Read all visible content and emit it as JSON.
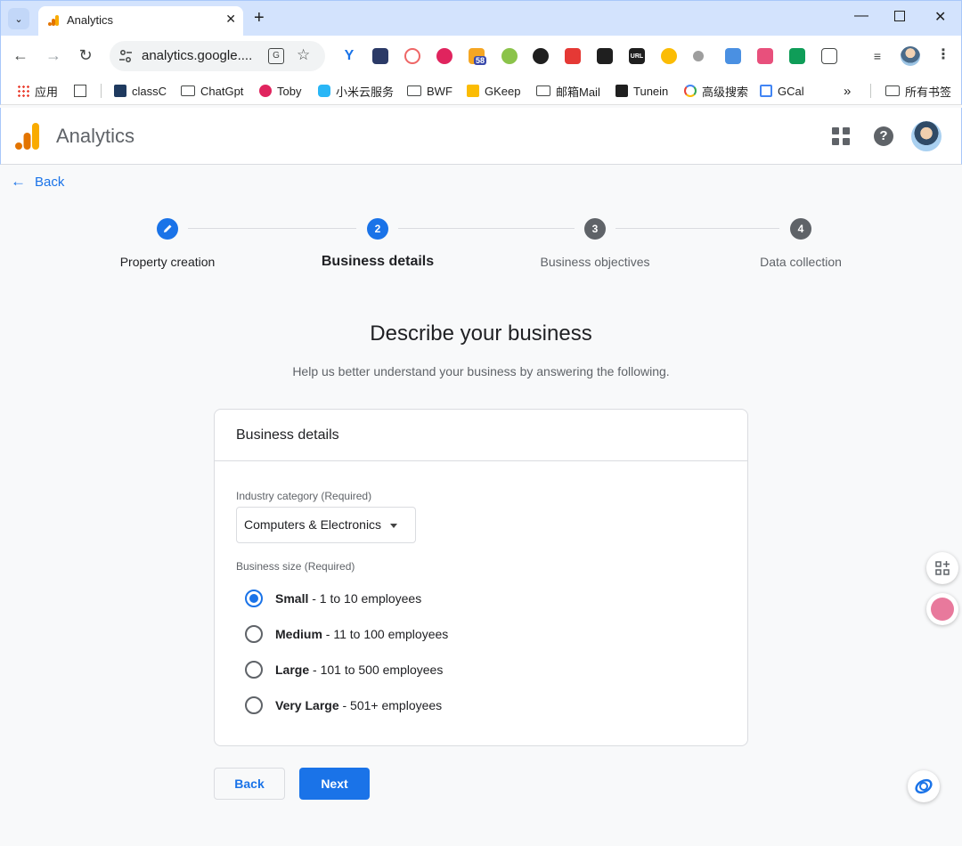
{
  "browser": {
    "tab_title": "Analytics",
    "url": "analytics.google....",
    "translate_glyph": "G",
    "bookmarks": [
      {
        "label": "应用"
      },
      {
        "label": ""
      },
      {
        "label": "classC"
      },
      {
        "label": "ChatGpt"
      },
      {
        "label": "Toby"
      },
      {
        "label": "小米云服务"
      },
      {
        "label": "BWF"
      },
      {
        "label": "GKeep"
      },
      {
        "label": "邮箱Mail"
      },
      {
        "label": "Tunein"
      },
      {
        "label": "高级搜索"
      },
      {
        "label": "GCal"
      },
      {
        "label": "所有书签"
      }
    ],
    "more_bookmarks": "»",
    "ext_badge": "58",
    "ext_url_label": "URL"
  },
  "app": {
    "name": "Analytics"
  },
  "back_link": "Back",
  "steps": [
    {
      "number": "",
      "label": "Property creation",
      "state": "done"
    },
    {
      "number": "2",
      "label": "Business details",
      "state": "active"
    },
    {
      "number": "3",
      "label": "Business objectives",
      "state": "todo"
    },
    {
      "number": "4",
      "label": "Data collection",
      "state": "todo"
    }
  ],
  "main": {
    "title": "Describe your business",
    "subtitle": "Help us better understand your business by answering the following."
  },
  "card": {
    "title": "Business details",
    "industry_label": "Industry category (Required)",
    "industry_value": "Computers & Electronics",
    "size_label": "Business size (Required)",
    "sizes": [
      {
        "name": "Small",
        "desc": " - 1 to 10 employees",
        "checked": true
      },
      {
        "name": "Medium",
        "desc": " - 11 to 100 employees",
        "checked": false
      },
      {
        "name": "Large",
        "desc": " - 101 to 500 employees",
        "checked": false
      },
      {
        "name": "Very Large",
        "desc": " - 501+ employees",
        "checked": false
      }
    ]
  },
  "buttons": {
    "back": "Back",
    "next": "Next"
  },
  "colors": {
    "accent": "#1a73e8",
    "step_todo": "#5f6368",
    "text_primary": "#202124",
    "text_secondary": "#5f6368"
  }
}
